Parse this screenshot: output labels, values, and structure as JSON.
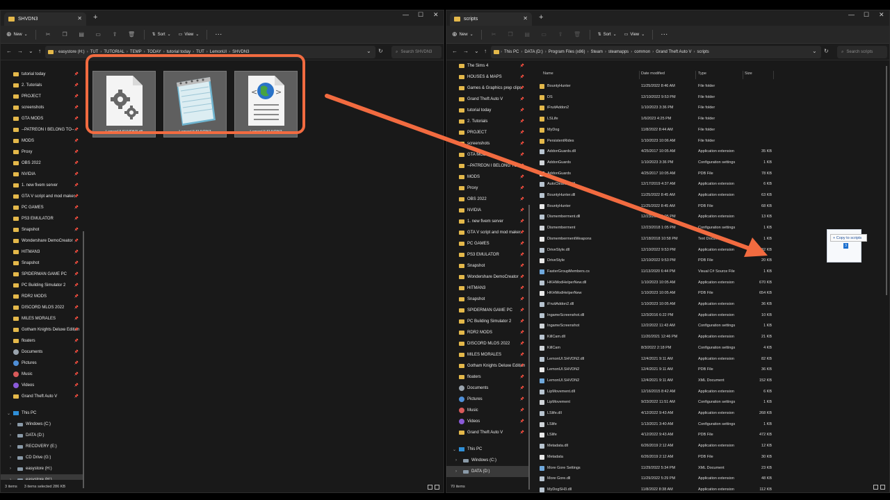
{
  "left": {
    "tab_title": "SHVDN3",
    "cmd": {
      "new": "New",
      "sort": "Sort",
      "view": "View",
      "more": "···"
    },
    "breadcrumbs": [
      "easystore (H:)",
      "TUT",
      "TUTORIAL",
      "TEMP",
      "TODAY",
      "tutorial today",
      "TUT",
      "LemonUI",
      "SHVDN3"
    ],
    "search_placeholder": "Search SHVDN3",
    "nav_items": [
      "tutorial today",
      "2. Tutorials",
      "PROJECT",
      "screenshots",
      "GTA MODS",
      "--PATREON I BELONG TO--",
      "MODS",
      "Proxy",
      "OBS 2022",
      "NVIDIA",
      "1. new fivem server",
      "GTA V script and mod maker",
      "PC GAMES",
      "PS3 EMULATOR",
      "Snapshot",
      "Wondershare DemoCreator",
      "HITMAN3",
      "Snapshot",
      "SPIDERMAN GAME PC",
      "PC Building Simulator 2",
      "RDR2 MODS",
      "DISCORD MLOS 2022",
      "MILES MORALES",
      "Gotham Knights Deluxe Edition",
      "floaters",
      "Documents",
      "Pictures",
      "Music",
      "Videos",
      "Grand Theft Auto V"
    ],
    "this_pc": "This PC",
    "drives": [
      "Windows (C:)",
      "DATA (D:)",
      "RECOVERY (E:)",
      "CD Drive (G:)",
      "easystore (H:)",
      "easystore (H:)"
    ],
    "files": [
      "LemonUI.SHVDN3.dll",
      "LemonUI.SHVDN3",
      "LemonUI.SHVDN3"
    ],
    "status": {
      "count": "3 items",
      "selected": "3 items selected  286 KB"
    }
  },
  "right": {
    "tab_title": "scripts",
    "cmd": {
      "new": "New",
      "sort": "Sort",
      "view": "View",
      "more": "···"
    },
    "breadcrumbs": [
      "This PC",
      "DATA (D:)",
      "Program Files (x86)",
      "Steam",
      "steamapps",
      "common",
      "Grand Theft Auto V",
      "scripts"
    ],
    "search_placeholder": "Search scripts",
    "nav_items": [
      "The Sims 4",
      "HOUSES & MAPS",
      "Games & Graphics prep clips",
      "Grand Theft Auto V",
      "tutorial today",
      "2. Tutorials",
      "PROJECT",
      "screenshots",
      "GTA MODS",
      "--PATREON I BELONG TO--",
      "MODS",
      "Proxy",
      "OBS 2022",
      "NVIDIA",
      "1. new fivem server",
      "GTA V script and mod maker",
      "PC GAMES",
      "PS3 EMULATOR",
      "Snapshot",
      "Wondershare DemoCreator",
      "HITMAN3",
      "Snapshot",
      "SPIDERMAN GAME PC",
      "PC Building Simulator 2",
      "RDR2 MODS",
      "DISCORD MLOS 2022",
      "MILES MORALES",
      "Gotham Knights Deluxe Edition",
      "floaters",
      "Documents",
      "Pictures",
      "Music",
      "Videos",
      "Grand Theft Auto V"
    ],
    "this_pc": "This PC",
    "drives": [
      "Windows (C:)",
      "DATA (D:)"
    ],
    "columns": {
      "name": "Name",
      "date": "Date modified",
      "type": "Type",
      "size": "Size"
    },
    "rows": [
      [
        "BountyHunter",
        "11/25/2022 8:46 AM",
        "File folder",
        ""
      ],
      [
        "DS",
        "12/10/2022 9:53 PM",
        "File folder",
        ""
      ],
      [
        "iFruitAddon2",
        "1/10/2023 3:36 PM",
        "File folder",
        ""
      ],
      [
        "LSLife",
        "1/6/2023 4:25 PM",
        "File folder",
        ""
      ],
      [
        "MyDog",
        "11/8/2022 8:44 AM",
        "File folder",
        ""
      ],
      [
        "PersistentRides",
        "1/10/2023 10:06 AM",
        "File folder",
        ""
      ],
      [
        "AddonGuards.dll",
        "4/25/2017 10:05 AM",
        "Application extension",
        "35 KB"
      ],
      [
        "AddonGuards",
        "1/10/2023 3:36 PM",
        "Configuration settings",
        "1 KB"
      ],
      [
        "AddonGuards",
        "4/25/2017 10:05 AM",
        "PDB File",
        "78 KB"
      ],
      [
        "AutoCleaning.dll",
        "12/17/2019 4:37 AM",
        "Application extension",
        "6 KB"
      ],
      [
        "BountyHunter.dll",
        "11/25/2022 8:45 AM",
        "Application extension",
        "63 KB"
      ],
      [
        "BountyHunter",
        "11/25/2022 8:45 AM",
        "PDB File",
        "68 KB"
      ],
      [
        "Dismemberment.dll",
        "12/23/2018 1:05 PM",
        "Application extension",
        "13 KB"
      ],
      [
        "Dismemberment",
        "12/23/2018 1:05 PM",
        "Configuration settings",
        "1 KB"
      ],
      [
        "DismembermentWeapons",
        "12/18/2018 10:58 PM",
        "Text Document",
        "1 KB"
      ],
      [
        "DriveStyle.dll",
        "12/10/2022 9:53 PM",
        "Application extension",
        "32 KB"
      ],
      [
        "DriveStyle",
        "12/10/2022 9:53 PM",
        "PDB File",
        "20 KB"
      ],
      [
        "FasterGroupMembers.cs",
        "11/13/2020 6:44 PM",
        "Visual C# Source File",
        "1 KB"
      ],
      [
        "HKHModHelperNew.dll",
        "1/10/2023 10:05 AM",
        "Application extension",
        "670 KB"
      ],
      [
        "HKHModHelperNew",
        "1/10/2023 10:05 AM",
        "PDB File",
        "654 KB"
      ],
      [
        "iFruitAddon2.dll",
        "1/10/2023 10:05 AM",
        "Application extension",
        "36 KB"
      ],
      [
        "IngameScreenshot.dll",
        "12/3/2016 6:22 PM",
        "Application extension",
        "10 KB"
      ],
      [
        "IngameScreenshot",
        "12/2/2022 11:43 AM",
        "Configuration settings",
        "1 KB"
      ],
      [
        "KillCam.dll",
        "11/20/2021 12:46 PM",
        "Application extension",
        "21 KB"
      ],
      [
        "KillCam",
        "8/3/2022 2:18 PM",
        "Configuration settings",
        "4 KB"
      ],
      [
        "LemonUI.SHVDN2.dll",
        "12/4/2021 9:11 AM",
        "Application extension",
        "82 KB"
      ],
      [
        "LemonUI.SHVDN2",
        "12/4/2021 9:11 AM",
        "PDB File",
        "36 KB"
      ],
      [
        "LemonUI.SHVDN2",
        "12/4/2021 9:11 AM",
        "XML Document",
        "152 KB"
      ],
      [
        "LipMovement.dll",
        "12/16/2015 8:42 AM",
        "Application extension",
        "6 KB"
      ],
      [
        "LipMovement",
        "9/23/2022 11:51 AM",
        "Configuration settings",
        "1 KB"
      ],
      [
        "LSlife.dll",
        "4/12/2022 9:43 AM",
        "Application extension",
        "268 KB"
      ],
      [
        "LSlife",
        "1/13/2021 3:40 AM",
        "Configuration settings",
        "1 KB"
      ],
      [
        "LSlife",
        "4/12/2022 9:43 AM",
        "PDB File",
        "472 KB"
      ],
      [
        "Metadata.dll",
        "6/26/2019 2:12 AM",
        "Application extension",
        "12 KB"
      ],
      [
        "Metadata",
        "6/26/2019 2:12 AM",
        "PDB File",
        "30 KB"
      ],
      [
        "More Gore Settings",
        "11/29/2022 5:34 PM",
        "XML Document",
        "23 KB"
      ],
      [
        "More Gore.dll",
        "11/29/2022 5:29 PM",
        "Application extension",
        "48 KB"
      ],
      [
        "MyDogSH3.dll",
        "11/8/2022 8:38 AM",
        "Application extension",
        "112 KB"
      ]
    ],
    "status": {
      "count": "70 items"
    }
  },
  "drag": {
    "tooltip": "+ Copy to scripts",
    "badge": "3"
  },
  "colors": {
    "accent": "#f26b40",
    "folder": "#e4b84a",
    "window_bg": "#191919",
    "selection_blue": "#1b6fcf"
  }
}
